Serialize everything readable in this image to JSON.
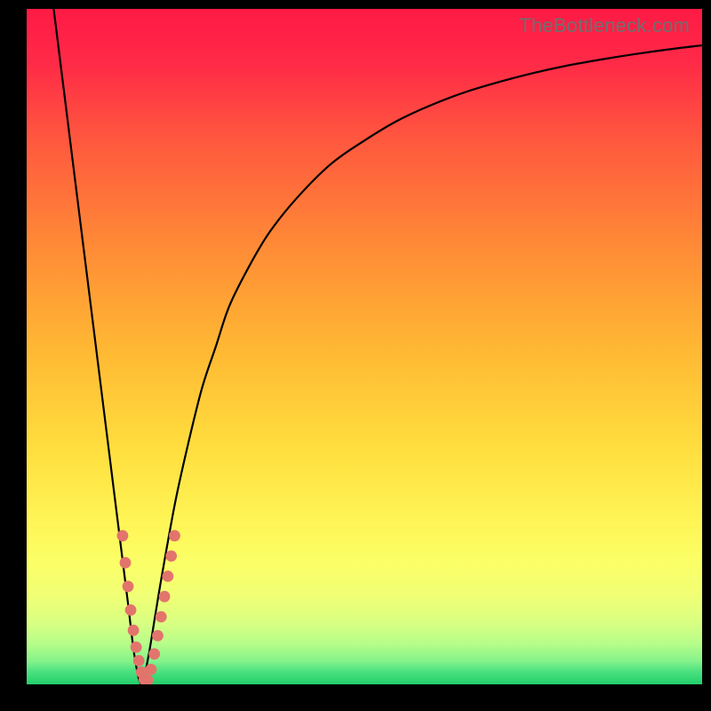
{
  "watermark": "TheBottleneck.com",
  "colors": {
    "black": "#000000",
    "curve": "#000000",
    "dot": "#e2746c",
    "grad_top": "#ff1a45",
    "grad_mid1": "#ff6a3a",
    "grad_mid2": "#ffb733",
    "grad_mid3": "#ffe84a",
    "grad_low1": "#faff66",
    "grad_low2": "#eaff80",
    "grad_green": "#2dd36f"
  },
  "chart_data": {
    "type": "line",
    "title": "",
    "xlabel": "",
    "ylabel": "",
    "xlim": [
      0,
      100
    ],
    "ylim": [
      0,
      100
    ],
    "series": [
      {
        "name": "bottleneck-curve",
        "x": [
          4,
          6,
          8,
          10,
          12,
          13,
          14,
          15,
          16,
          17,
          18,
          19,
          20,
          22,
          24,
          26,
          28,
          30,
          33,
          36,
          40,
          45,
          50,
          55,
          60,
          65,
          70,
          75,
          80,
          85,
          90,
          95,
          100
        ],
        "y": [
          100,
          84,
          68,
          52,
          36,
          28,
          20,
          12,
          4,
          0,
          4,
          10,
          16,
          27,
          36,
          44,
          50,
          56,
          62,
          67,
          72,
          77,
          80.5,
          83.5,
          85.8,
          87.7,
          89.2,
          90.5,
          91.6,
          92.5,
          93.3,
          94,
          94.6
        ]
      }
    ],
    "points": [
      {
        "x": 14.2,
        "y": 22
      },
      {
        "x": 14.6,
        "y": 18
      },
      {
        "x": 15.0,
        "y": 14.5
      },
      {
        "x": 15.4,
        "y": 11
      },
      {
        "x": 15.8,
        "y": 8
      },
      {
        "x": 16.2,
        "y": 5.5
      },
      {
        "x": 16.6,
        "y": 3.5
      },
      {
        "x": 17.0,
        "y": 1.8
      },
      {
        "x": 17.4,
        "y": 0.7
      },
      {
        "x": 17.9,
        "y": 0.6
      },
      {
        "x": 18.4,
        "y": 2.2
      },
      {
        "x": 18.9,
        "y": 4.5
      },
      {
        "x": 19.4,
        "y": 7.2
      },
      {
        "x": 19.9,
        "y": 10
      },
      {
        "x": 20.4,
        "y": 13
      },
      {
        "x": 20.9,
        "y": 16
      },
      {
        "x": 21.4,
        "y": 19
      },
      {
        "x": 21.9,
        "y": 22
      }
    ],
    "annotations": []
  }
}
